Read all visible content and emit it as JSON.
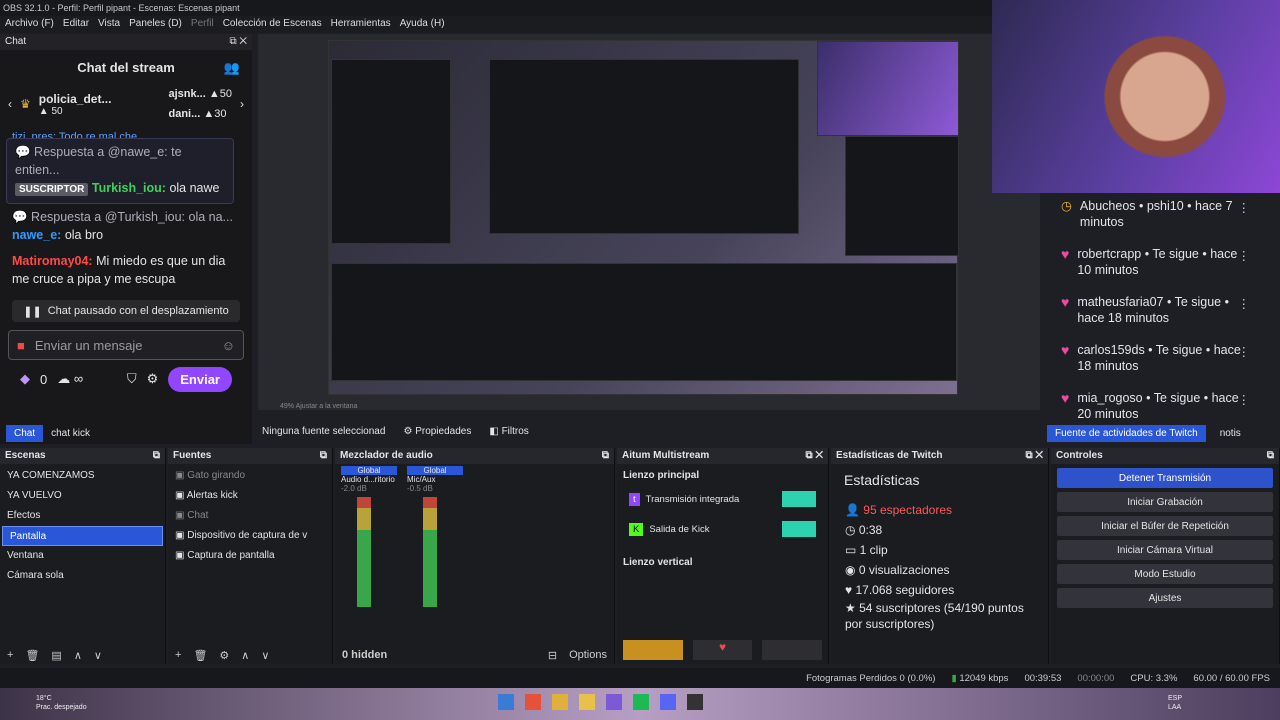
{
  "window": {
    "title": "OBS 32.1.0 - Perfil: Perfil pipant - Escenas: Escenas pipant"
  },
  "menu": [
    "Archivo (F)",
    "Editar",
    "Vista",
    "Paneles (D)",
    "Perfil",
    "Colección de Escenas",
    "Herramientas",
    "Ayuda (H)"
  ],
  "chat": {
    "dock_title": "Chat",
    "stream_title": "Chat del stream",
    "leaders": [
      {
        "name": "policia_det...",
        "score": "50"
      },
      {
        "name": "ajsnk...",
        "score": "50"
      },
      {
        "name": "dani...",
        "score": "30"
      }
    ],
    "cut_message": "tizi_pres: Todo re mal che",
    "reply1": "Respuesta a @nawe_e: te entien...",
    "badge": "SUSCRIPTOR",
    "user1": "Turkish_iou:",
    "msg1": "ola nawe",
    "reply2": "Respuesta a @Turkish_iou: ola na...",
    "user2": "nawe_e:",
    "msg2": "ola bro",
    "user3": "Matiromay04:",
    "msg3": "Mi miedo es que un dia me cruce a pipa y me escupa",
    "paused": "Chat pausado con el desplazamiento",
    "input_placeholder": "Enviar un mensaje",
    "points": "0",
    "send": "Enviar"
  },
  "preview": {
    "zoom": "49%",
    "fit": "Ajustar a la ventana"
  },
  "feed": {
    "items": [
      {
        "icon": "clock",
        "text": "Abucheos • pshi10 • hace 7 minutos"
      },
      {
        "icon": "heart",
        "text": "robertcrapp • Te sigue • hace 10 minutos"
      },
      {
        "icon": "heart",
        "text": "matheusfaria07 • Te sigue • hace 18 minutos"
      },
      {
        "icon": "heart",
        "text": "carlos159ds • Te sigue • hace 18 minutos"
      },
      {
        "icon": "heart",
        "text": "mia_rogoso • Te sigue • hace 20 minutos"
      }
    ]
  },
  "tabs_left": [
    "Chat",
    "chat kick"
  ],
  "source_bar": {
    "none": "Ninguna fuente seleccionad",
    "props": "Propiedades",
    "filters": "Filtros"
  },
  "tabs_right": [
    "Fuente de actividades de Twitch",
    "notis"
  ],
  "scenes": {
    "title": "Escenas",
    "items": [
      "YA COMENZAMOS",
      "YA VUELVO",
      "Efectos",
      "Pantalla",
      "Ventana",
      "Cámara sola"
    ]
  },
  "sources": {
    "title": "Fuentes",
    "items": [
      {
        "name": "Gato girando",
        "dim": true
      },
      {
        "name": "Alertas kick",
        "dim": false
      },
      {
        "name": "Chat",
        "dim": true
      },
      {
        "name": "Dispositivo de captura de v",
        "dim": false
      },
      {
        "name": "Captura de pantalla",
        "dim": false
      }
    ]
  },
  "mixer": {
    "title": "Mezclador de audio",
    "ch1": {
      "group": "Global",
      "name": "Audio d...ritorio",
      "db": "-2.0 dB"
    },
    "ch2": {
      "group": "Global",
      "name": "Mic/Aux",
      "db": "-0.5 dB"
    },
    "hidden": "0 hidden",
    "options": "Options",
    "ticks": [
      "0",
      "-6",
      "-12",
      "-18",
      "-24",
      "-30",
      "-36",
      "-42",
      "-48",
      "-54",
      "-60"
    ]
  },
  "multistream": {
    "title": "Aitum Multistream",
    "main": "Lienzo principal",
    "out1": "Transmisión integrada",
    "out2": "Salida de Kick",
    "vertical": "Lienzo vertical"
  },
  "stats": {
    "title": "Estadísticas de Twitch",
    "heading": "Estadísticas",
    "viewers": "95 espectadores",
    "uptime": "0:38",
    "clips": "1 clip",
    "views": "0 visualizaciones",
    "followers": "17.068 seguidores",
    "subs": "54 suscriptores (54/190 puntos por suscriptores)"
  },
  "controls": {
    "title": "Controles",
    "buttons": [
      "Detener Transmisión",
      "Iniciar Grabación",
      "Iniciar el Búfer de Repetición",
      "Iniciar Cámara Virtual",
      "Modo Estudio",
      "Ajustes"
    ]
  },
  "status": {
    "dropped": "Fotogramas Perdidos 0 (0.0%)",
    "kbps": "12049 kbps",
    "stream_time": "00:39:53",
    "rec_time": "00:00:00",
    "cpu": "CPU: 3.3%",
    "fps": "60.00 / 60.00 FPS"
  },
  "taskbar": {
    "temp": "18°C",
    "weather": "Prac. despejado",
    "lang": "ESP LAA"
  },
  "colors": {
    "accent": "#2a57d7",
    "twitch": "#9147ff",
    "kick": "#53fc18",
    "red": "#eb4b4b"
  }
}
